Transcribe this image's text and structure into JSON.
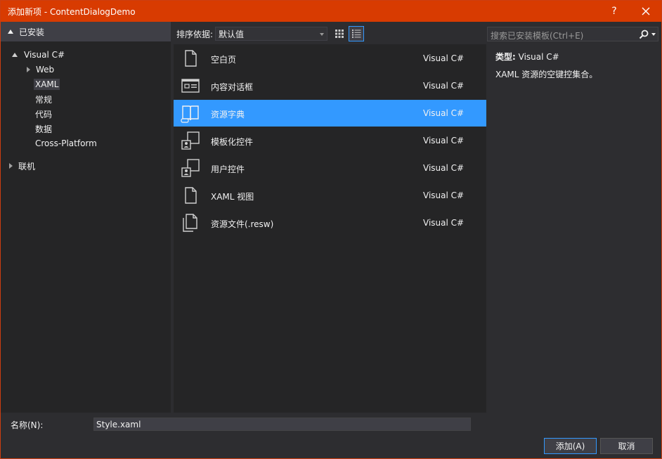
{
  "window": {
    "title": "添加新项 - ContentDialogDemo",
    "help_label": "?"
  },
  "left": {
    "header": "已安装",
    "tree": [
      {
        "label": "Visual C#",
        "expanded": true
      },
      {
        "label": "Web",
        "expanded": false
      },
      {
        "label": "XAML",
        "selected": true
      },
      {
        "label": "常规"
      },
      {
        "label": "代码"
      },
      {
        "label": "数据"
      },
      {
        "label": "Cross-Platform"
      },
      {
        "label": "联机",
        "expanded": false
      }
    ]
  },
  "toolbar": {
    "sort_label": "排序依据:",
    "sort_value": "默认值"
  },
  "templates": [
    {
      "name": "空白页",
      "lang": "Visual C#",
      "icon": "blank-page-icon"
    },
    {
      "name": "内容对话框",
      "lang": "Visual C#",
      "icon": "content-dialog-icon"
    },
    {
      "name": "资源字典",
      "lang": "Visual C#",
      "icon": "resource-dictionary-icon",
      "selected": true
    },
    {
      "name": "模板化控件",
      "lang": "Visual C#",
      "icon": "templated-control-icon"
    },
    {
      "name": "用户控件",
      "lang": "Visual C#",
      "icon": "user-control-icon"
    },
    {
      "name": "XAML 视图",
      "lang": "Visual C#",
      "icon": "xaml-view-icon"
    },
    {
      "name": "资源文件(.resw)",
      "lang": "Visual C#",
      "icon": "resource-file-icon"
    }
  ],
  "search": {
    "placeholder": "搜索已安装模板(Ctrl+E)"
  },
  "details": {
    "type_label": "类型:",
    "type_value": "Visual C#",
    "description": "XAML 资源的空键控集合。"
  },
  "bottom": {
    "name_label": "名称(N):",
    "name_value": "Style.xaml",
    "add_label": "添加(A)",
    "cancel_label": "取消"
  },
  "colors": {
    "titlebar": "#d83b01",
    "selection": "#3399ff",
    "panel": "#252526",
    "background": "#2d2d30"
  }
}
